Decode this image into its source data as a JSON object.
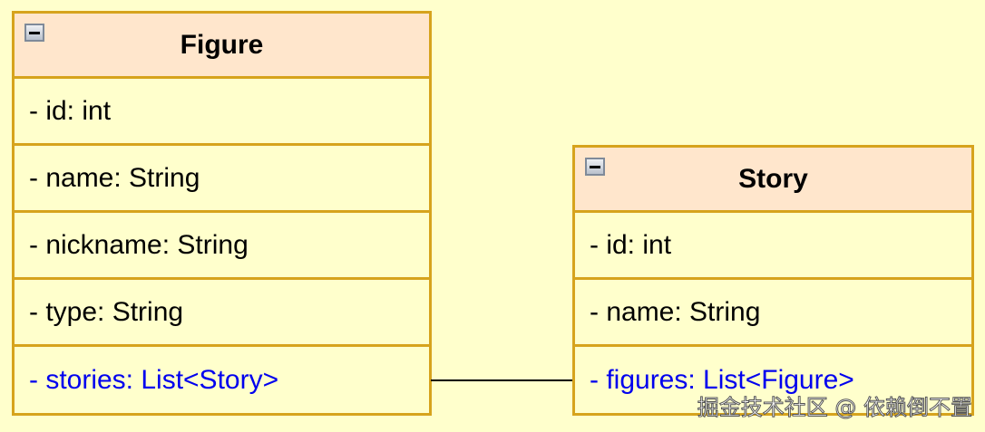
{
  "classes": [
    {
      "name": "Figure",
      "attributes": [
        "- id: int",
        "- name: String",
        "- nickname: String",
        "- type: String"
      ],
      "relation": "- stories: List<Story>"
    },
    {
      "name": "Story",
      "attributes": [
        "- id: int",
        "- name: String"
      ],
      "relation": "- figures: List<Figure>"
    }
  ],
  "watermark": "掘金技术社区 @ 依赖倒不置",
  "colors": {
    "border": "#d6a31d",
    "header": "#ffe6cc",
    "body": "#ffffcc",
    "relation_text": "#0000ee"
  }
}
